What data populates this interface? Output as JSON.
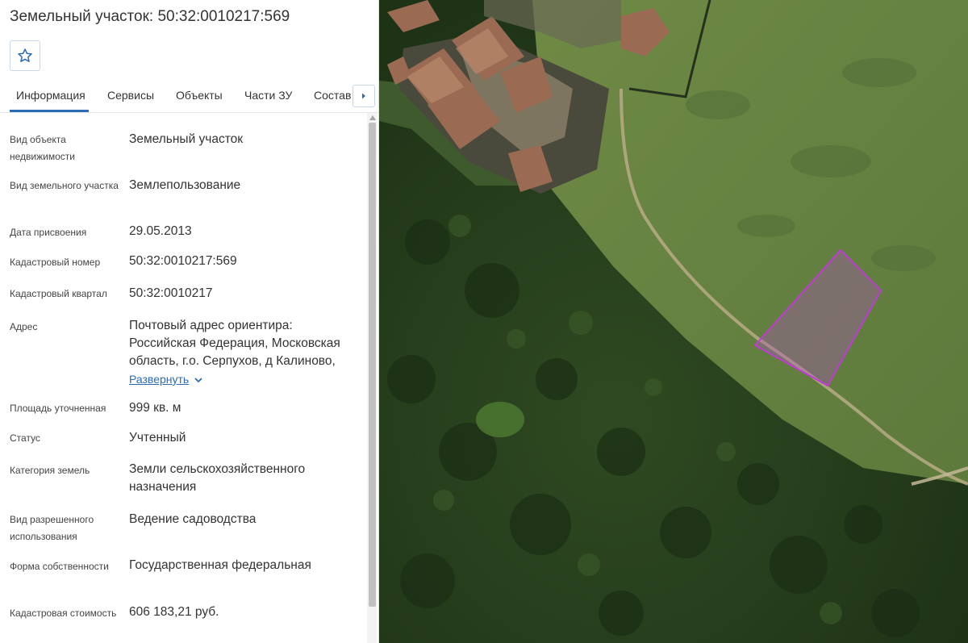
{
  "panel": {
    "title": "Земельный участок: 50:32:0010217:569",
    "tabs": [
      {
        "label": "Информация"
      },
      {
        "label": "Сервисы"
      },
      {
        "label": "Объекты"
      },
      {
        "label": "Части ЗУ"
      },
      {
        "label": "Состав"
      }
    ],
    "fields": [
      {
        "label": "Вид объекта недвижимости",
        "value": "Земельный участок"
      },
      {
        "label": "Вид земельного участка",
        "value": "Землепользование"
      },
      {
        "label": "Дата присвоения",
        "value": "29.05.2013"
      },
      {
        "label": "Кадастровый номер",
        "value": "50:32:0010217:569"
      },
      {
        "label": "Кадастровый квартал",
        "value": "50:32:0010217"
      },
      {
        "label": "Адрес",
        "value": "Почтовый адрес ориентира: Российская Федерация, Московская область, г.о. Серпухов, д Калиново,"
      },
      {
        "label": "Площадь уточненная",
        "value": "999 кв. м"
      },
      {
        "label": "Статус",
        "value": "Учтенный"
      },
      {
        "label": "Категория земель",
        "value": "Земли сельскохозяйственного назначения"
      },
      {
        "label": "Вид разрешенного использования",
        "value": "Ведение садоводства"
      },
      {
        "label": "Форма собственности",
        "value": "Государственная федеральная"
      },
      {
        "label": "Кадастровая стоимость",
        "value": "606 183,21 руб."
      }
    ],
    "expand_label": "Развернуть"
  },
  "icons": {
    "favorite": "star-outline-icon",
    "tabs_next": "chevron-right-icon",
    "expand": "chevron-down-icon"
  },
  "colors": {
    "accent": "#2b6cb5",
    "parcel_outline": "#c03bd6",
    "parcel_fill": "#b04fc8"
  }
}
